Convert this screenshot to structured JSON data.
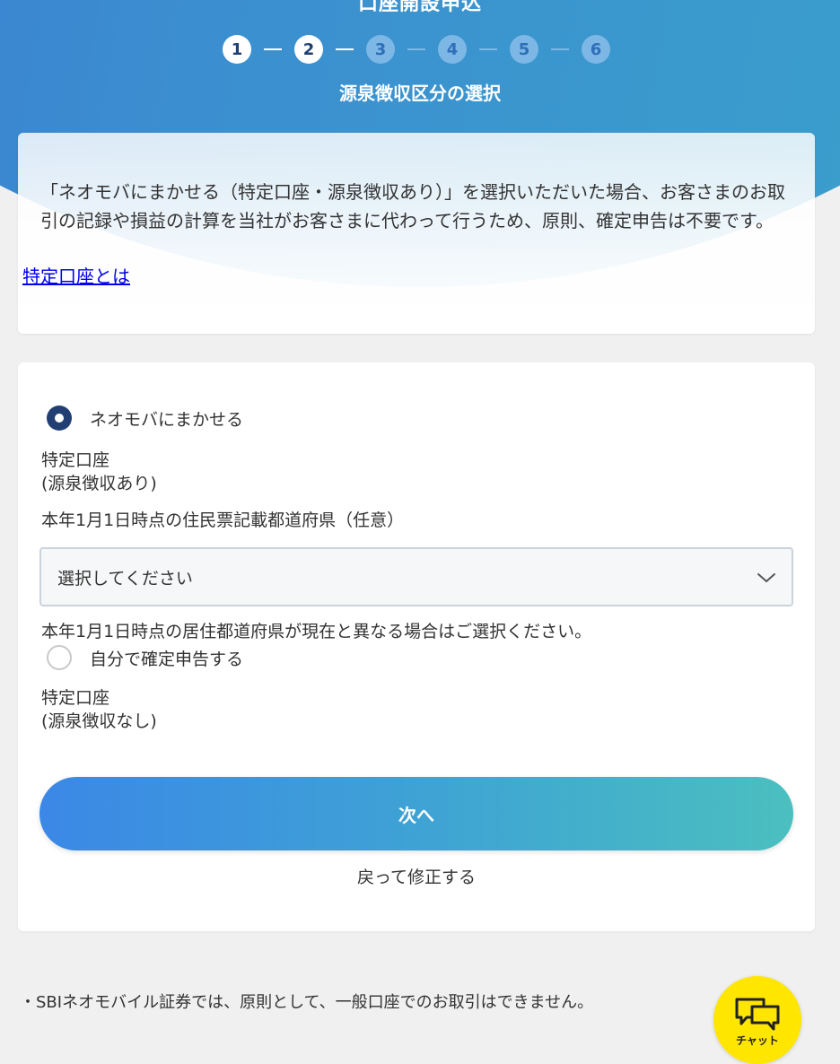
{
  "header": {
    "title": "口座開設申込",
    "steps": [
      "1",
      "2",
      "3",
      "4",
      "5",
      "6"
    ],
    "current_step": 2,
    "step_heading": "源泉徴収区分の選択"
  },
  "info": {
    "text": "「ネオモバにまかせる（特定口座・源泉徴収あり）」を選択いただいた場合、お客さまのお取引の記録や損益の計算を当社がお客さまに代わって行うため、原則、確定申告は不要です。",
    "link": "特定口座とは"
  },
  "form": {
    "option1": {
      "label": "ネオモバにまかせる",
      "selected": true,
      "sub_line1": "特定口座",
      "sub_line2": "(源泉徴収あり)"
    },
    "prefecture_label": "本年1月1日時点の住民票記載都道府県（任意）",
    "prefecture_select": "選択してください",
    "prefecture_note": "本年1月1日時点の居住都道府県が現在と異なる場合はご選択ください。",
    "option2": {
      "label": "自分で確定申告する",
      "selected": false,
      "sub_line1": "特定口座",
      "sub_line2": "(源泉徴収なし)"
    },
    "next_button": "次へ",
    "back_link": "戻って修正する"
  },
  "footer": {
    "note": "・SBIネオモバイル証券では、原則として、一般口座でのお取引はできません。"
  },
  "chat": {
    "label": "チャット"
  },
  "colors": {
    "radio_selected": "#223f73",
    "button_gradient_start": "#3b88e6",
    "button_gradient_end": "#4bbfbf",
    "chat_button": "#ffe600"
  }
}
